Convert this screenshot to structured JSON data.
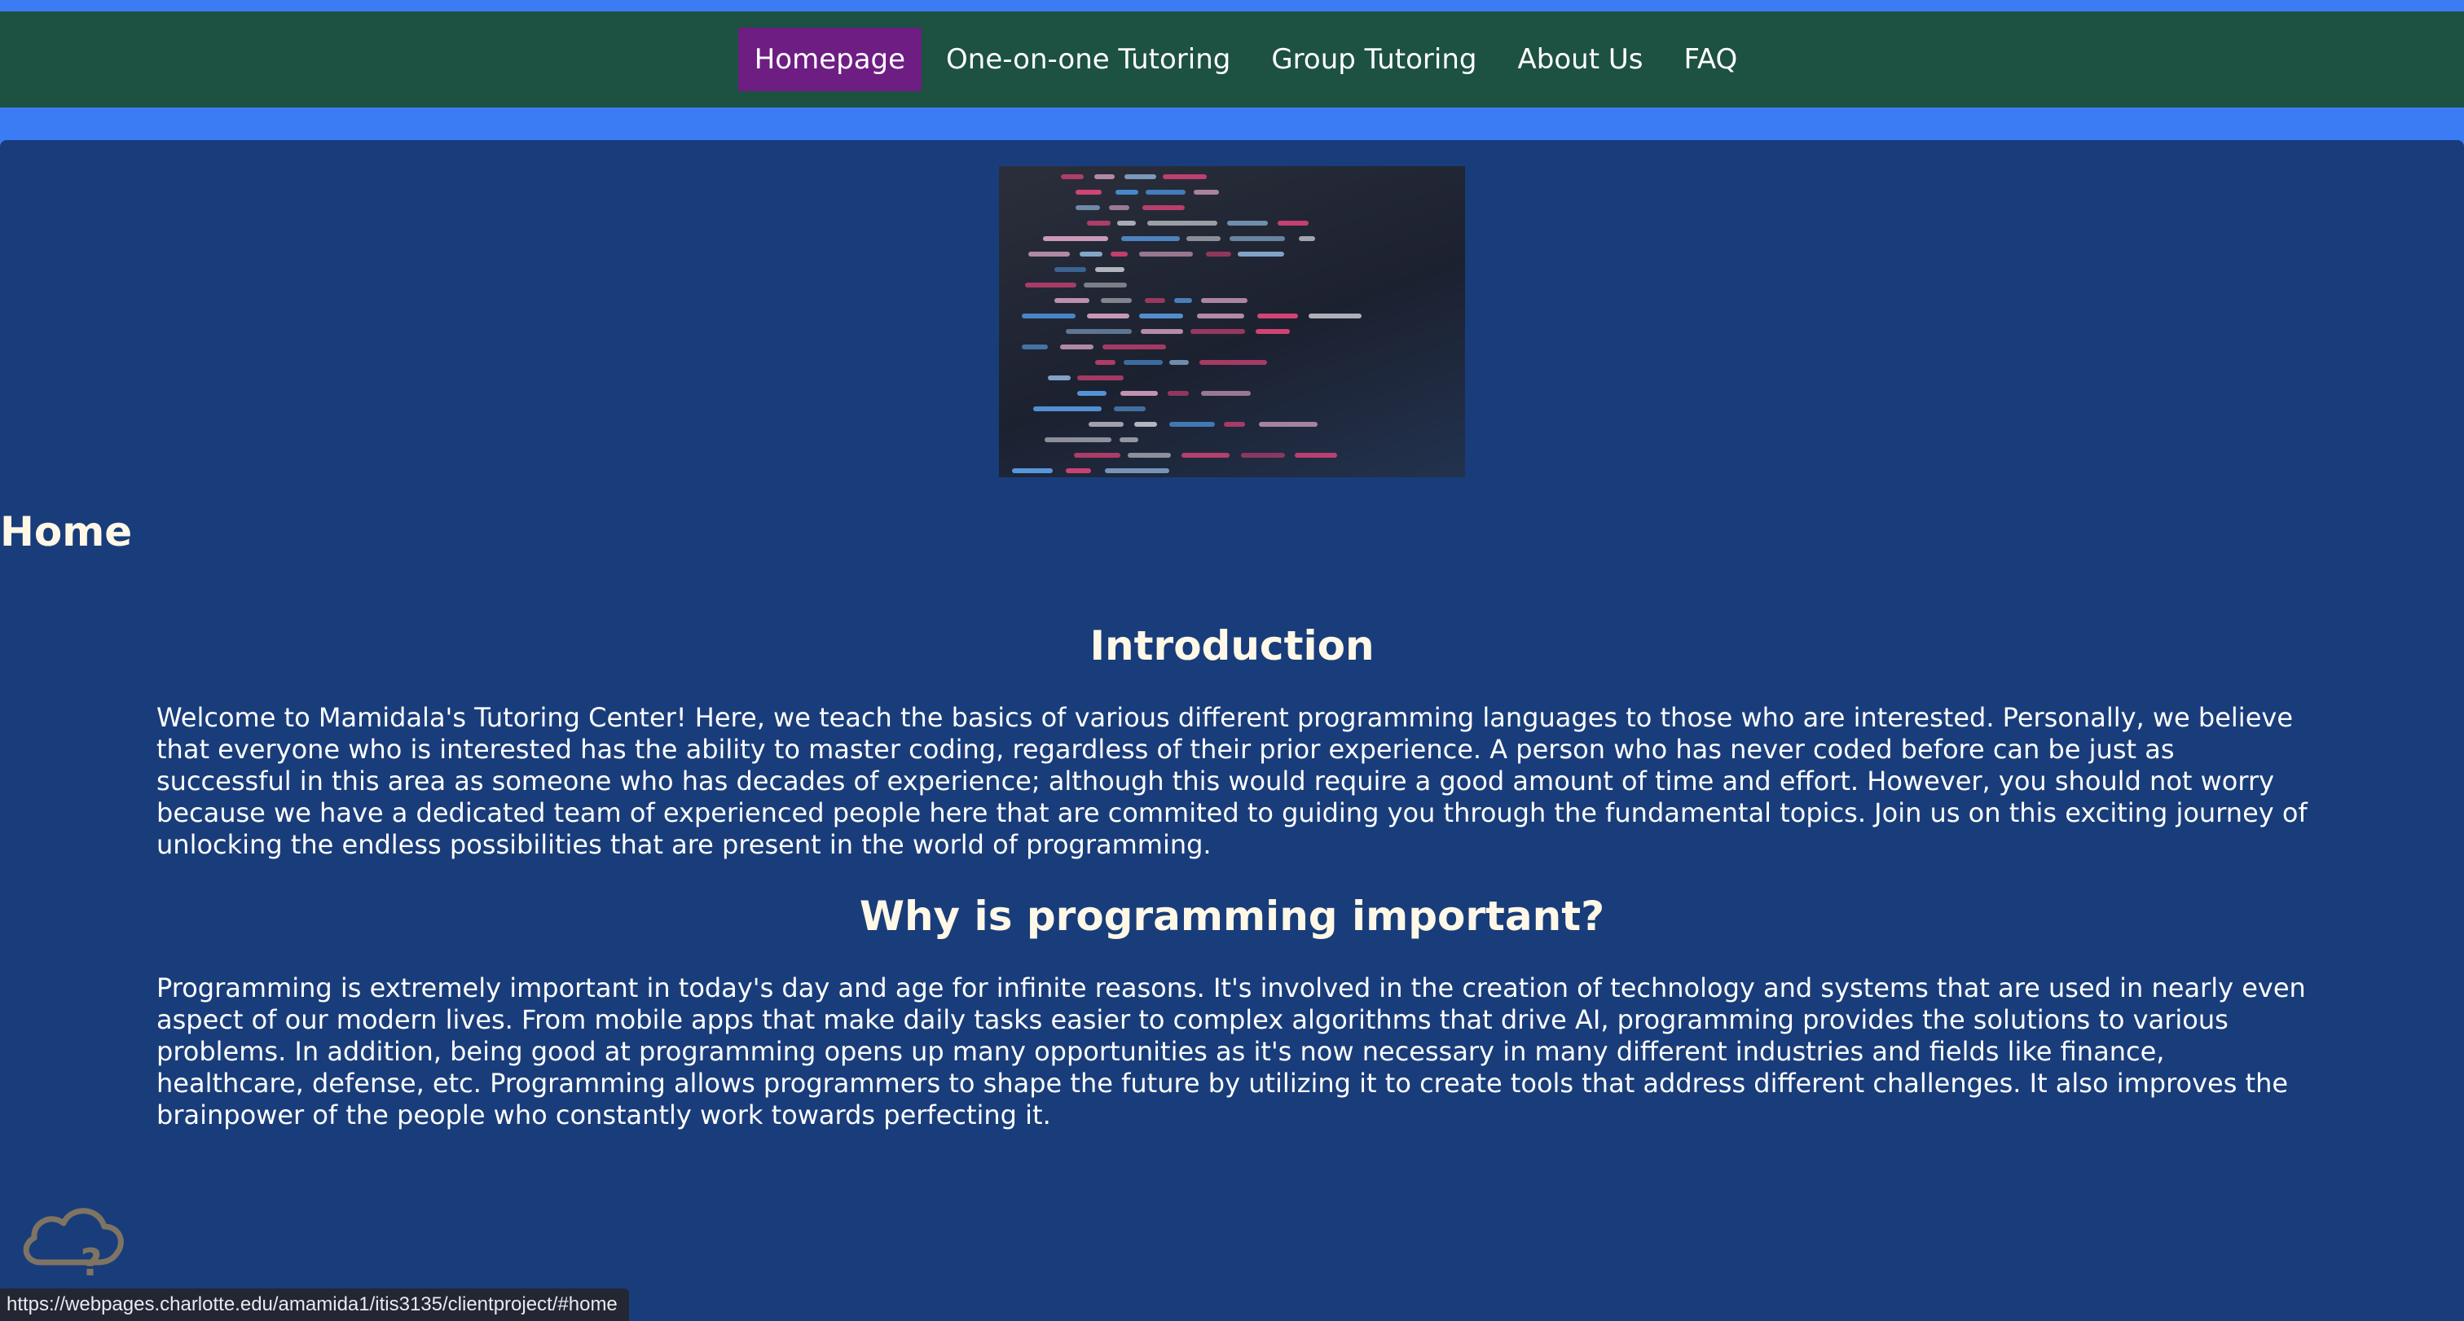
{
  "nav": {
    "items": [
      {
        "label": "Homepage",
        "active": true
      },
      {
        "label": "One-on-one Tutoring",
        "active": false
      },
      {
        "label": "Group Tutoring",
        "active": false
      },
      {
        "label": "About Us",
        "active": false
      },
      {
        "label": "FAQ",
        "active": false
      }
    ]
  },
  "hero": {
    "icon": "code-screen-image"
  },
  "main": {
    "page_title": "Home",
    "sections": [
      {
        "heading": "Introduction",
        "body": "Welcome to Mamidala's Tutoring Center! Here, we teach the basics of various different programming languages to those who are interested. Personally, we believe that everyone who is interested has the ability to master coding, regardless of their prior experience. A person who has never coded before can be just as successful in this area as someone who has decades of experience; although this would require a good amount of time and effort. However, you should not worry because we have a dedicated team of experienced people here that are commited to guiding you through the fundamental topics. Join us on this exciting journey of unlocking the endless possibilities that are present in the world of programming."
      },
      {
        "heading": "Why is programming important?",
        "body": "Programming is extremely important in today's day and age for infinite reasons. It's involved in the creation of technology and systems that are used in nearly even aspect of our modern lives. From mobile apps that make daily tasks easier to complex algorithms that drive AI, programming provides the solutions to various problems. In addition, being good at programming opens up many opportunities as it's now necessary in many different industries and fields like finance, healthcare, defense, etc. Programming allows programmers to shape the future by utilizing it to create tools that address different challenges. It also improves the brainpower of the people who constantly work towards perfecting it."
      }
    ]
  },
  "widget": {
    "icon": "cloud-question-icon"
  },
  "status_bar": {
    "url": "https://webpages.charlotte.edu/amamida1/itis3135/clientproject/#home"
  },
  "colors": {
    "accent_blue": "#3b7cf5",
    "nav_green": "#1d5141",
    "active_purple": "#6e1d83",
    "content_navy": "#193d7b"
  }
}
